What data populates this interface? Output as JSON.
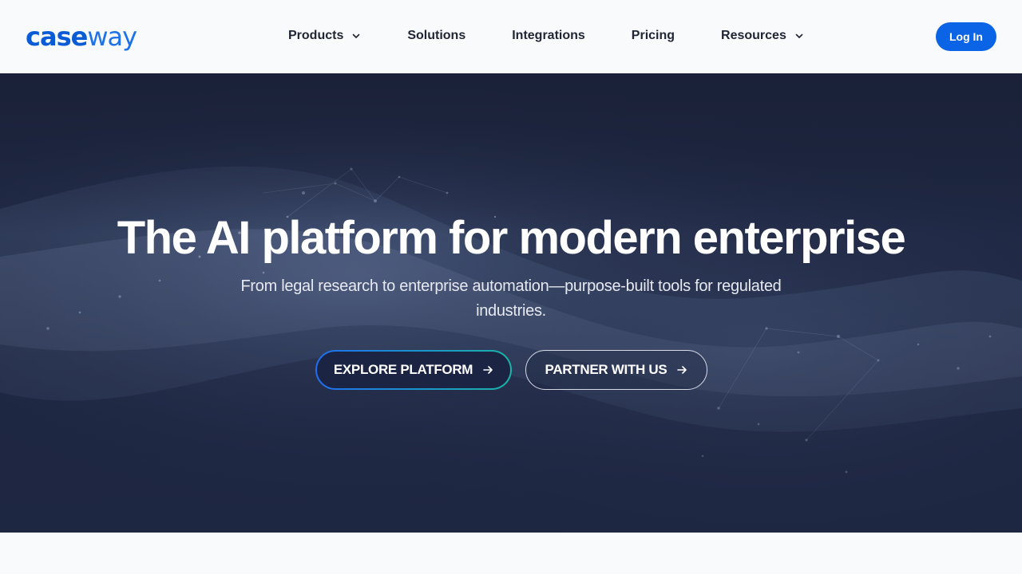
{
  "header": {
    "logo_bold": "case",
    "logo_light": "way",
    "nav": [
      {
        "label": "Products",
        "has_dropdown": true
      },
      {
        "label": "Solutions",
        "has_dropdown": false
      },
      {
        "label": "Integrations",
        "has_dropdown": false
      },
      {
        "label": "Pricing",
        "has_dropdown": false
      },
      {
        "label": "Resources",
        "has_dropdown": true
      }
    ],
    "login_label": "Log In"
  },
  "hero": {
    "title": "The AI platform for modern enterprise",
    "subtitle": "From legal research to enterprise automation—purpose-built tools for regulated industries.",
    "primary_cta": "EXPLORE PLATFORM",
    "secondary_cta": "PARTNER WITH US"
  },
  "icons": {
    "dropdown": "chevron-down-icon",
    "cta": "arrow-right-icon"
  },
  "colors": {
    "brand": "#0b63e5",
    "hero_bg": "#1e2742",
    "cta_gradient_start": "#1e6ff0",
    "cta_gradient_end": "#19b5a8",
    "nav_text": "#1f2533"
  }
}
